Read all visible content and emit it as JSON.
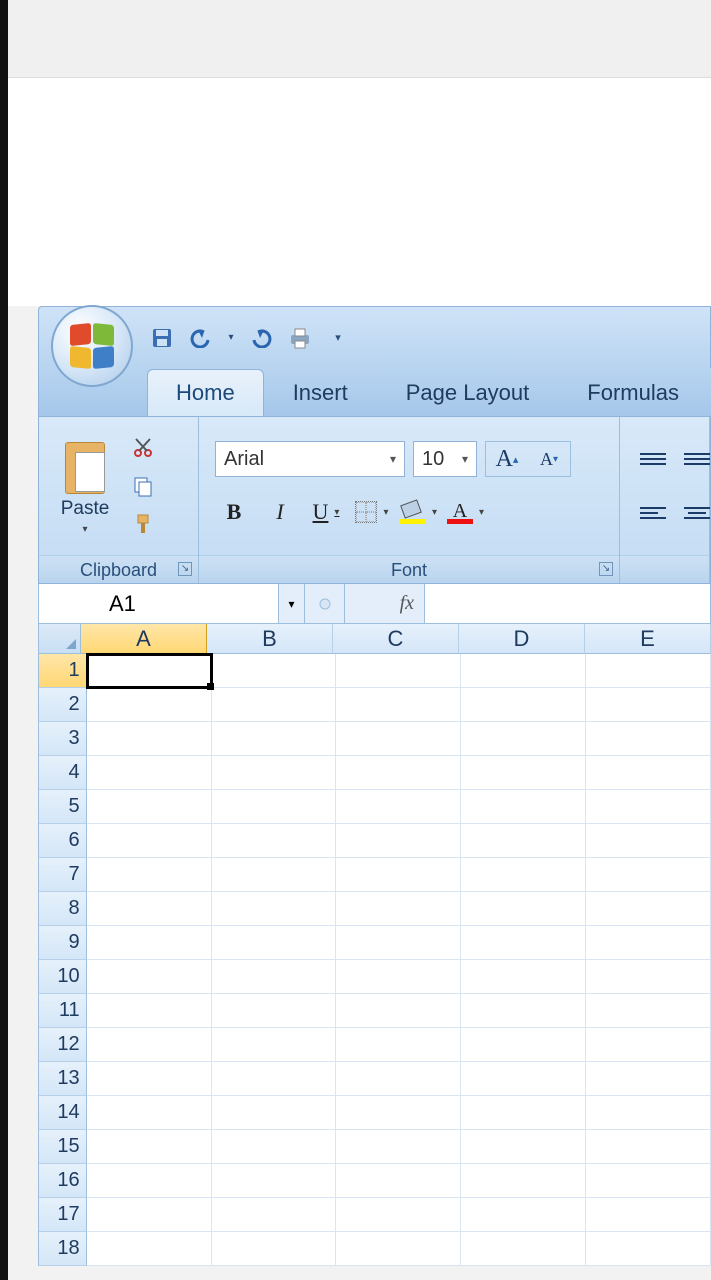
{
  "tabs": [
    "Home",
    "Insert",
    "Page Layout",
    "Formulas"
  ],
  "active_tab": "Home",
  "qat": {
    "save": "save-icon",
    "undo": "undo-icon",
    "redo": "redo-icon",
    "print": "quick-print-icon",
    "customize": "customize-qat-icon"
  },
  "clipboard": {
    "paste_label": "Paste",
    "group_label": "Clipboard"
  },
  "font": {
    "name": "Arial",
    "size": "10",
    "group_label": "Font"
  },
  "namebox": "A1",
  "fx_label": "fx",
  "formula_value": "",
  "columns": [
    "A",
    "B",
    "C",
    "D",
    "E"
  ],
  "rows": [
    1,
    2,
    3,
    4,
    5,
    6,
    7,
    8,
    9,
    10,
    11,
    12,
    13,
    14,
    15,
    16,
    17,
    18
  ],
  "selected_cell": {
    "row": 1,
    "col": "A"
  }
}
